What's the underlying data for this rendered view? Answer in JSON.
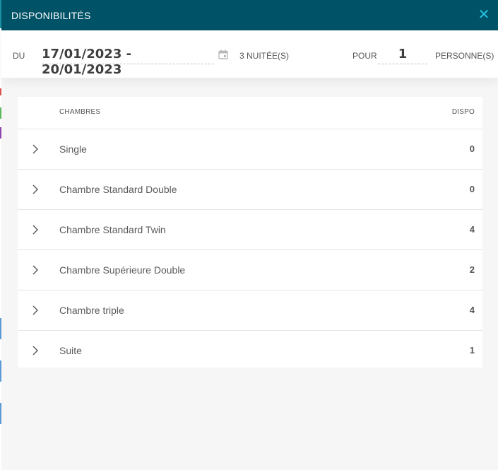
{
  "dialog": {
    "title": "DISPONIBILITÉS",
    "close_icon": "close-icon"
  },
  "search": {
    "from_label": "DU",
    "date_range": "17/01/2023 - 20/01/2023",
    "calendar_icon": "calendar-icon",
    "nights": "3 NUITÉE(S)",
    "for_label": "POUR",
    "persons": "1",
    "persons_label": "PERSONNE(S)"
  },
  "table": {
    "col_rooms": "CHAMBRES",
    "col_dispo": "DISPO",
    "rows": [
      {
        "name": "Single",
        "dispo": "0"
      },
      {
        "name": "Chambre Standard Double",
        "dispo": "0"
      },
      {
        "name": "Chambre Standard Twin",
        "dispo": "4"
      },
      {
        "name": "Chambre Supérieure Double",
        "dispo": "2"
      },
      {
        "name": "Chambre triple",
        "dispo": "4"
      },
      {
        "name": "Suite",
        "dispo": "1"
      }
    ]
  },
  "colors": {
    "header_bg": "#005267",
    "close_icon": "#27c3e6",
    "page_bg": "#f6f6f6"
  }
}
